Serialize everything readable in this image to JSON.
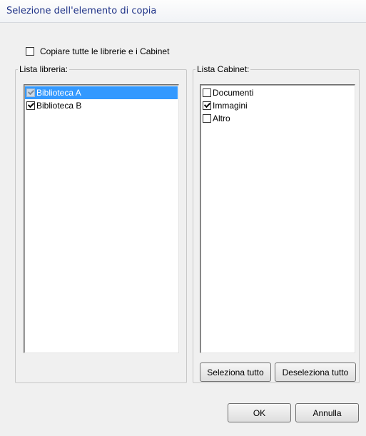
{
  "window": {
    "title": "Selezione dell'elemento di copia"
  },
  "copy_all": {
    "label": "Copiare tutte le librerie e i Cabinet",
    "checked": false
  },
  "library_list": {
    "label": "Lista libreria:",
    "items": [
      {
        "label": "Biblioteca A",
        "checked": true,
        "selected": true,
        "disabled": true
      },
      {
        "label": "Biblioteca B",
        "checked": true,
        "selected": false,
        "disabled": false
      }
    ]
  },
  "cabinet_list": {
    "label": "Lista Cabinet:",
    "items": [
      {
        "label": "Documenti",
        "checked": false
      },
      {
        "label": "Immagini",
        "checked": true
      },
      {
        "label": "Altro",
        "checked": false
      }
    ],
    "select_all_label": "Seleziona tutto",
    "deselect_all_label": "Deseleziona tutto"
  },
  "buttons": {
    "ok_label": "OK",
    "cancel_label": "Annulla"
  },
  "colors": {
    "selection": "#3399ff",
    "title_text": "#1e3287",
    "dialog_bg": "#f0f0f0"
  }
}
